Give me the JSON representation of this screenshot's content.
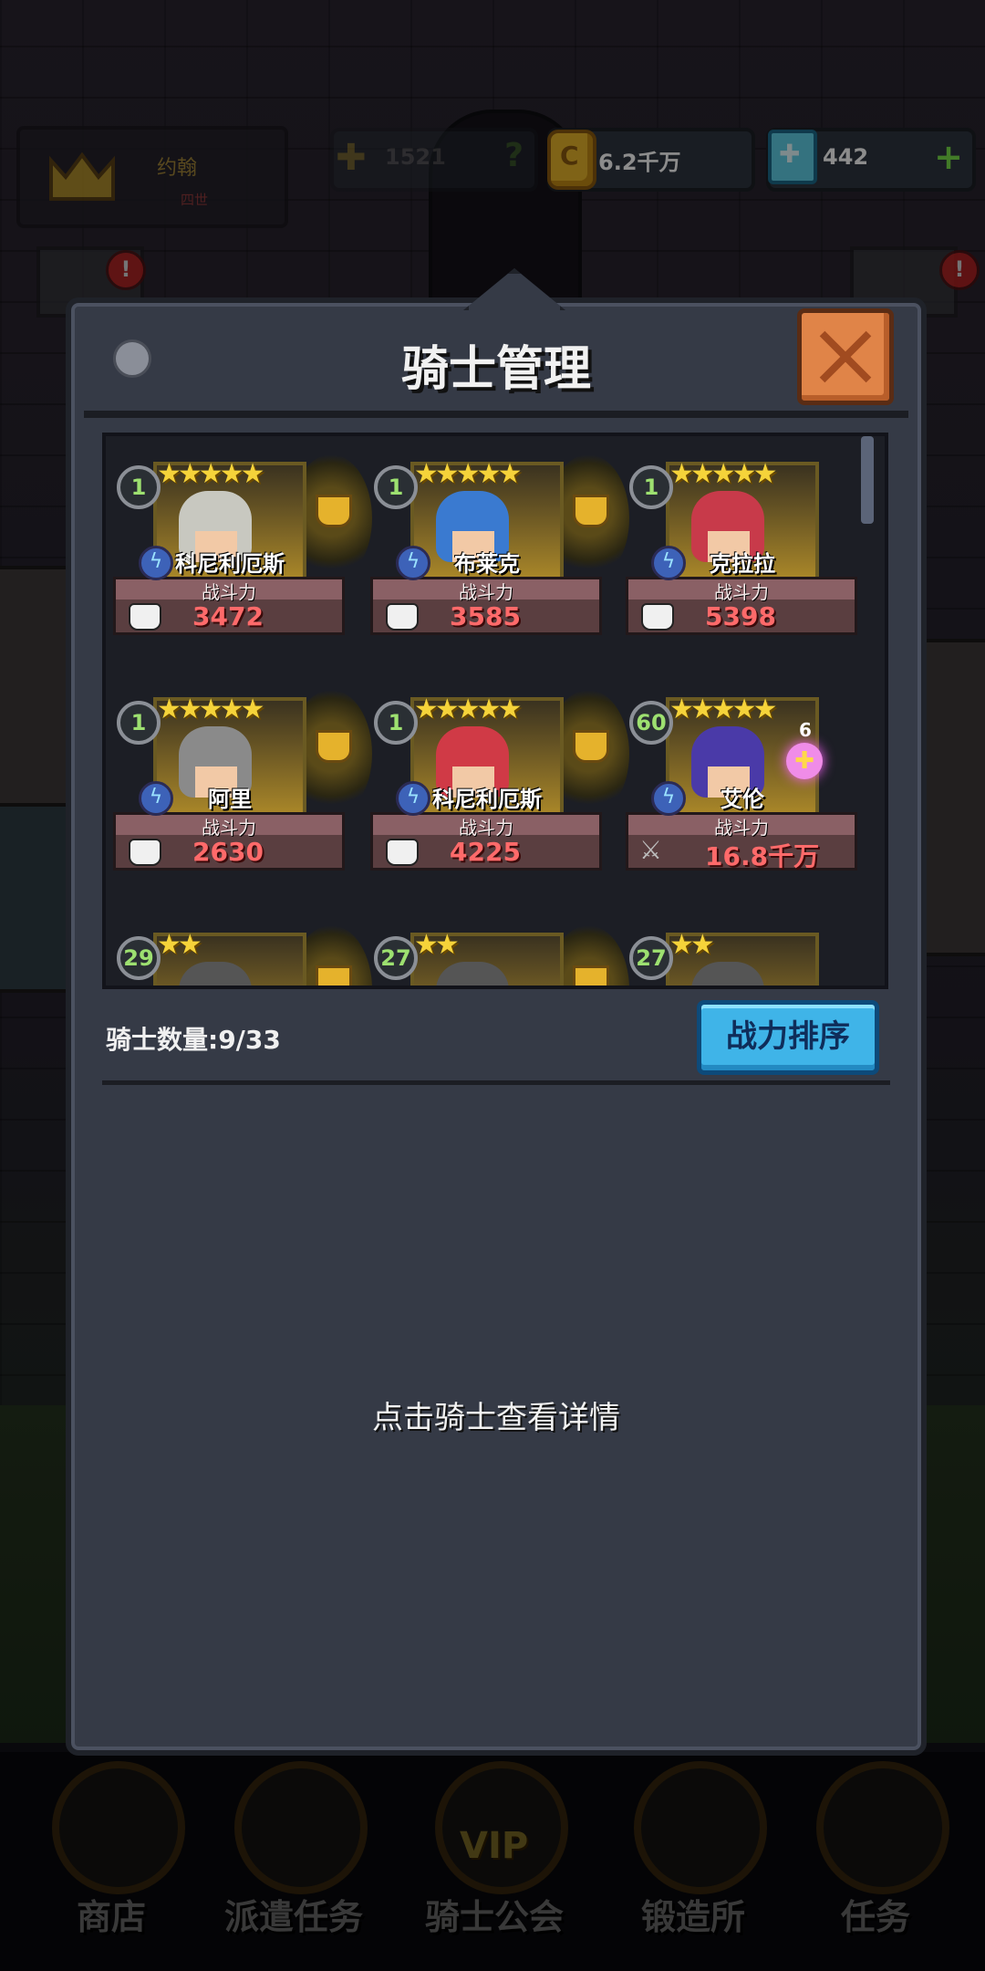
{
  "hud": {
    "player_name": "约翰",
    "player_sub": "四世",
    "power": "1521",
    "gold": "6.2千万",
    "gems": "442"
  },
  "dialog": {
    "title": "骑士管理",
    "knight_count": "骑士数量:9/33",
    "sort_button": "战力排序",
    "hint": "点击骑士查看详情"
  },
  "knights": [
    {
      "level": "1",
      "stars": "★★★★★",
      "name": "科尼利厄斯",
      "cp_label": "战斗力",
      "cp": "3472",
      "hair": "#c8c8c0"
    },
    {
      "level": "1",
      "stars": "★★★★★",
      "name": "布莱克",
      "cp_label": "战斗力",
      "cp": "3585",
      "hair": "#3a7ad0"
    },
    {
      "level": "1",
      "stars": "★★★★★",
      "name": "克拉拉",
      "cp_label": "战斗力",
      "cp": "5398",
      "hair": "#c83a4a"
    },
    {
      "level": "1",
      "stars": "★★★★★",
      "name": "阿里",
      "cp_label": "战斗力",
      "cp": "2630",
      "hair": "#8a8a8a"
    },
    {
      "level": "1",
      "stars": "★★★★★",
      "name": "科尼利厄斯",
      "cp_label": "战斗力",
      "cp": "4225",
      "hair": "#d03a46"
    },
    {
      "level": "60",
      "stars": "★★★★★",
      "name": "艾伦",
      "cp_label": "战斗力",
      "cp": "16.8千万",
      "hair": "#4a3aa8",
      "bond": "6"
    },
    {
      "level": "29",
      "stars": "★★"
    },
    {
      "level": "27",
      "stars": "★★"
    },
    {
      "level": "27",
      "stars": "★★"
    }
  ],
  "nav": {
    "shop": "商店",
    "dispatch": "派遣任务",
    "guild": "骑士公会",
    "vip": "VIP",
    "forge": "锻造所",
    "quests": "任务"
  },
  "colors": {
    "accent_blue": "#3fb4e8",
    "close_orange": "#e08448",
    "star_gold": "#f5d33a",
    "cp_red": "#ff6a6a"
  }
}
